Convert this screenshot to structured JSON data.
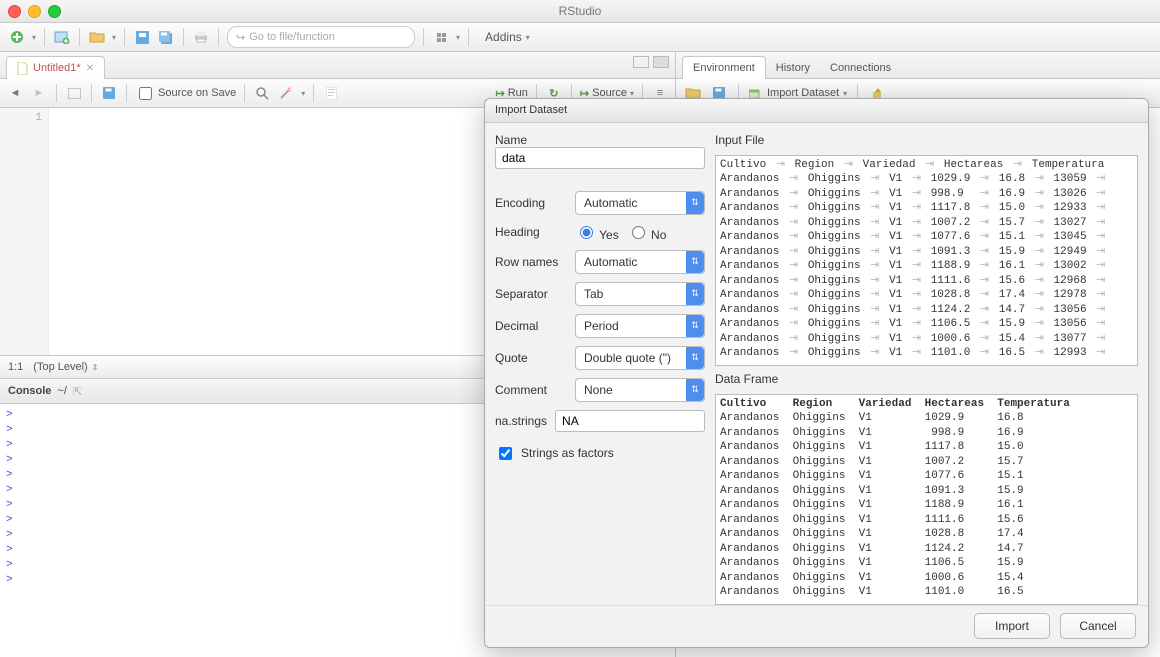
{
  "app": {
    "title": "RStudio"
  },
  "maintoolbar": {
    "search_placeholder": "Go to file/function",
    "addins_label": "Addins"
  },
  "source": {
    "tab_label": "Untitled1*",
    "save_on_source": "Source on Save",
    "run_label": "Run",
    "source_label": "Source",
    "gutter_line": "1",
    "status_pos": "1:1",
    "status_scope": "(Top Level)"
  },
  "console": {
    "header": "Console",
    "cwd": "~/",
    "prompts": [
      ">",
      ">",
      ">",
      ">",
      ">",
      ">",
      ">",
      ">",
      ">",
      ">",
      ">",
      ">"
    ]
  },
  "env": {
    "tabs": [
      "Environment",
      "History",
      "Connections"
    ],
    "import_label": "Import Dataset"
  },
  "dialog": {
    "title": "Import Dataset",
    "name_label": "Name",
    "name_value": "data",
    "encoding_label": "Encoding",
    "encoding_value": "Automatic",
    "heading_label": "Heading",
    "heading_yes": "Yes",
    "heading_no": "No",
    "rownames_label": "Row names",
    "rownames_value": "Automatic",
    "separator_label": "Separator",
    "separator_value": "Tab",
    "decimal_label": "Decimal",
    "decimal_value": "Period",
    "quote_label": "Quote",
    "quote_value": "Double quote (\")",
    "comment_label": "Comment",
    "comment_value": "None",
    "na_label": "na.strings",
    "na_value": "NA",
    "strings_as_factors": "Strings as factors",
    "input_file_label": "Input File",
    "data_frame_label": "Data Frame",
    "import_btn": "Import",
    "cancel_btn": "Cancel",
    "columns": [
      "Cultivo",
      "Region",
      "Variedad",
      "Hectareas",
      "Temperatura"
    ],
    "extra_input_col": "",
    "input_rows": [
      [
        "Arandanos",
        "Ohiggins",
        "V1",
        "1029.9",
        "16.8",
        "13059"
      ],
      [
        "Arandanos",
        "Ohiggins",
        "V1",
        "998.9",
        "16.9",
        "13026"
      ],
      [
        "Arandanos",
        "Ohiggins",
        "V1",
        "1117.8",
        "15.0",
        "12933"
      ],
      [
        "Arandanos",
        "Ohiggins",
        "V1",
        "1007.2",
        "15.7",
        "13027"
      ],
      [
        "Arandanos",
        "Ohiggins",
        "V1",
        "1077.6",
        "15.1",
        "13045"
      ],
      [
        "Arandanos",
        "Ohiggins",
        "V1",
        "1091.3",
        "15.9",
        "12949"
      ],
      [
        "Arandanos",
        "Ohiggins",
        "V1",
        "1188.9",
        "16.1",
        "13002"
      ],
      [
        "Arandanos",
        "Ohiggins",
        "V1",
        "1111.6",
        "15.6",
        "12968"
      ],
      [
        "Arandanos",
        "Ohiggins",
        "V1",
        "1028.8",
        "17.4",
        "12978"
      ],
      [
        "Arandanos",
        "Ohiggins",
        "V1",
        "1124.2",
        "14.7",
        "13056"
      ],
      [
        "Arandanos",
        "Ohiggins",
        "V1",
        "1106.5",
        "15.9",
        "13056"
      ],
      [
        "Arandanos",
        "Ohiggins",
        "V1",
        "1000.6",
        "15.4",
        "13077"
      ],
      [
        "Arandanos",
        "Ohiggins",
        "V1",
        "1101.0",
        "16.5",
        "12993"
      ]
    ],
    "frame_rows": [
      [
        "Arandanos",
        "Ohiggins",
        "V1",
        "1029.9",
        "16.8"
      ],
      [
        "Arandanos",
        "Ohiggins",
        "V1",
        " 998.9",
        "16.9"
      ],
      [
        "Arandanos",
        "Ohiggins",
        "V1",
        "1117.8",
        "15.0"
      ],
      [
        "Arandanos",
        "Ohiggins",
        "V1",
        "1007.2",
        "15.7"
      ],
      [
        "Arandanos",
        "Ohiggins",
        "V1",
        "1077.6",
        "15.1"
      ],
      [
        "Arandanos",
        "Ohiggins",
        "V1",
        "1091.3",
        "15.9"
      ],
      [
        "Arandanos",
        "Ohiggins",
        "V1",
        "1188.9",
        "16.1"
      ],
      [
        "Arandanos",
        "Ohiggins",
        "V1",
        "1111.6",
        "15.6"
      ],
      [
        "Arandanos",
        "Ohiggins",
        "V1",
        "1028.8",
        "17.4"
      ],
      [
        "Arandanos",
        "Ohiggins",
        "V1",
        "1124.2",
        "14.7"
      ],
      [
        "Arandanos",
        "Ohiggins",
        "V1",
        "1106.5",
        "15.9"
      ],
      [
        "Arandanos",
        "Ohiggins",
        "V1",
        "1000.6",
        "15.4"
      ],
      [
        "Arandanos",
        "Ohiggins",
        "V1",
        "1101.0",
        "16.5"
      ]
    ]
  }
}
